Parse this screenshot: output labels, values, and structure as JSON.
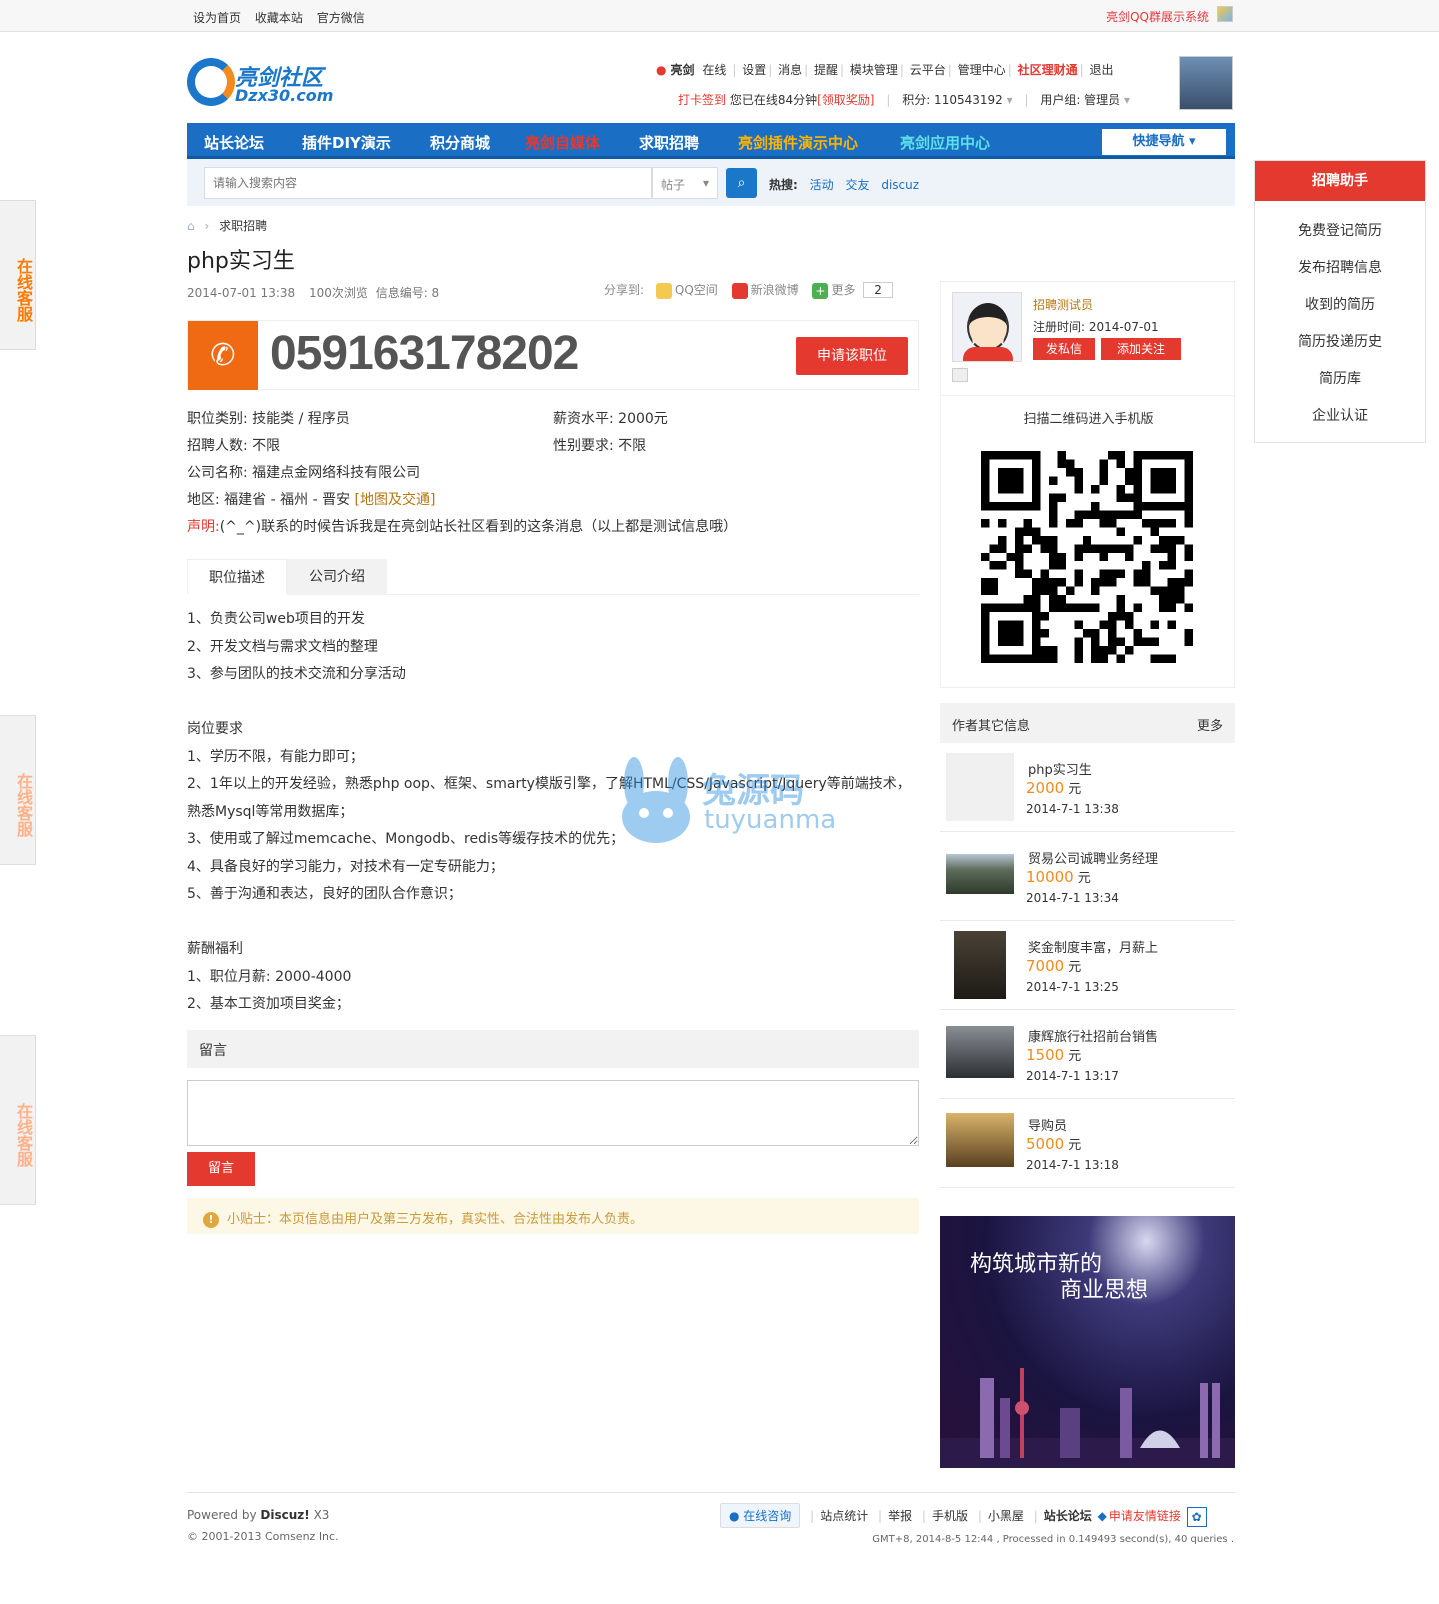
{
  "topbar": {
    "links": [
      "设为首页",
      "收藏本站",
      "官方微信"
    ],
    "right_link": "亮剑QQ群展示系统"
  },
  "side_tabs": [
    "在线客服",
    "在线客服",
    "在线客服"
  ],
  "logo": {
    "cn": "亮剑社区",
    "en": "Dzx30.com"
  },
  "user_bar": {
    "username": "亮剑",
    "online": "在线",
    "links": [
      "设置",
      "消息",
      "提醒",
      "模块管理",
      "云平台",
      "管理中心"
    ],
    "highlight": "社区理财通",
    "logout": "退出",
    "checkin": "打卡签到",
    "online_time": "您已在线84分钟",
    "reward": "[领取奖励]",
    "points": "积分: 110543192",
    "usergroup": "用户组: 管理员"
  },
  "nav": {
    "items": [
      "站长论坛",
      "插件DIY演示",
      "积分商城",
      "亮剑自媒体",
      "求职招聘",
      "亮剑插件演示中心",
      "亮剑应用中心"
    ],
    "colors": [
      "#ffffff",
      "#ffffff",
      "#ffffff",
      "#e4392f",
      "#ffffff",
      "#ffb400",
      "#5ee0e8"
    ],
    "quick_nav": "快捷导航"
  },
  "search": {
    "placeholder": "请输入搜索内容",
    "type": "帖子",
    "hot_label": "热搜:",
    "hot": [
      "活动",
      "交友",
      "discuz"
    ]
  },
  "breadcrumb": {
    "current": "求职招聘"
  },
  "post": {
    "title": "php实习生",
    "date": "2014-07-01 13:38",
    "views": "100次浏览",
    "info_no": "信息编号: 8",
    "share_label": "分享到:",
    "share_qq": "QQ空间",
    "share_weibo": "新浪微博",
    "share_more": "更多",
    "share_count": "2",
    "phone": "059163178202",
    "apply": "申请该职位"
  },
  "fields": {
    "category": "职位类别: 技能类 / 程序员",
    "salary": "薪资水平: 2000元",
    "count": "招聘人数: 不限",
    "gender": "性别要求: 不限",
    "company": "公司名称: 福建点金网络科技有限公司",
    "region": "地区: 福建省 - 福州 - 晋安",
    "map_link": "[地图及交通]",
    "statement_label": "声明:",
    "statement": "(^_^)联系的时候告诉我是在亮剑站长社区看到的这条消息（以上都是测试信息哦）"
  },
  "tabs": [
    "职位描述",
    "公司介绍"
  ],
  "description": [
    "1、负责公司web项目的开发",
    "2、开发文档与需求文档的整理",
    "3、参与团队的技术交流和分享活动",
    "",
    "岗位要求",
    "1、学历不限，有能力即可；",
    "2、1年以上的开发经验，熟悉php oop、框架、smarty模版引擎，了解HTML/CSS/Javascript/Jquery等前端技术，熟悉Mysql等常用数据库；",
    "3、使用或了解过memcache、Mongodb、redis等缓存技术的优先；",
    "4、具备良好的学习能力，对技术有一定专研能力；",
    "5、善于沟通和表达，良好的团队合作意识；",
    "",
    "薪酬福利",
    "1、职位月薪: 2000-4000",
    "2、基本工资加项目奖金；"
  ],
  "message": {
    "header": "留言",
    "button": "留言",
    "tip": "小贴士：本页信息由用户及第三方发布，真实性、合法性由发布人负责。"
  },
  "watermark": {
    "cn": "兔源码",
    "en": "tuyuanma"
  },
  "profile": {
    "name": "招聘测试员",
    "reg": "注册时间: 2014-07-01",
    "msg_btn": "发私信",
    "follow_btn": "添加关注"
  },
  "qr": {
    "caption": "扫描二维码进入手机版"
  },
  "other_info": {
    "header": "作者其它信息",
    "more": "更多",
    "unit": "元",
    "items": [
      {
        "title": "php实习生",
        "price": "2000",
        "date": "2014-7-1 13:38"
      },
      {
        "title": "贸易公司诚聘业务经理",
        "price": "10000",
        "date": "2014-7-1 13:34"
      },
      {
        "title": "奖金制度丰富，月薪上",
        "price": "7000",
        "date": "2014-7-1 13:25"
      },
      {
        "title": "康辉旅行社招前台销售",
        "price": "1500",
        "date": "2014-7-1 13:17"
      },
      {
        "title": "导购员",
        "price": "5000",
        "date": "2014-7-1 13:18"
      }
    ]
  },
  "banner": {
    "line1": "构筑城市新的",
    "line2": "商业思想"
  },
  "assistant": {
    "header": "招聘助手",
    "items": [
      "免费登记简历",
      "发布招聘信息",
      "收到的简历",
      "简历投递历史",
      "简历库",
      "企业认证"
    ]
  },
  "footer": {
    "powered_prefix": "Powered by",
    "powered_name": "Discuz!",
    "powered_ver": "X3",
    "copyright": "© 2001-2013 Comsenz Inc.",
    "consult": "在线咨询",
    "links": [
      "站点统计",
      "举报",
      "手机版",
      "小黑屋"
    ],
    "forum": "站长论坛",
    "friend": "申请友情链接",
    "stats": "GMT+8, 2014-8-5 12:44 , Processed in 0.149493 second(s), 40 queries ."
  }
}
